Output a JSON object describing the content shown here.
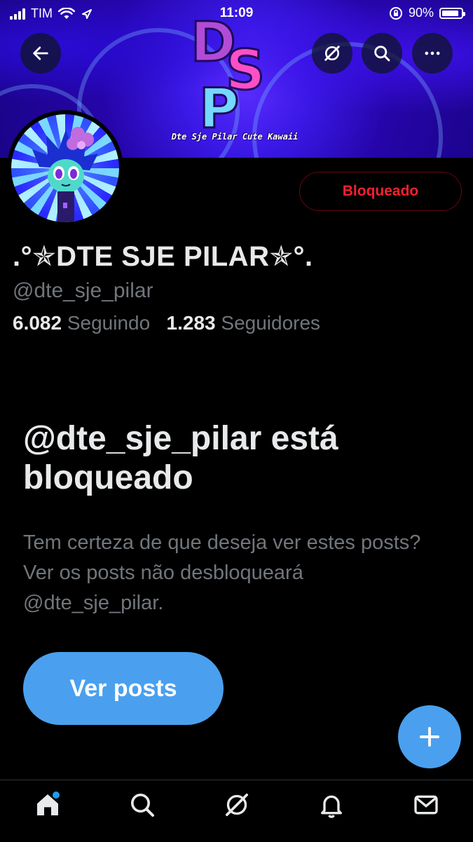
{
  "status_bar": {
    "carrier": "TIM",
    "time": "11:09",
    "battery_percent": "90%",
    "battery_level": 0.9,
    "icons": [
      "signal-icon",
      "wifi-icon",
      "location-icon",
      "orientation-lock-icon",
      "battery-icon"
    ]
  },
  "header": {
    "banner_logo_letters": [
      "D",
      "S",
      "P"
    ],
    "banner_tagline": "Dte Sje Pilar Cute Kawaii",
    "icons": [
      "back-arrow-icon",
      "grok-icon",
      "search-icon",
      "more-icon"
    ]
  },
  "profile": {
    "blocked_button_label": "Bloqueado",
    "display_name": ".°✯DTE SJE PILAR✯°.",
    "handle": "@dte_sje_pilar",
    "following_count": "6.082",
    "following_label": "Seguindo",
    "followers_count": "1.283",
    "followers_label": "Seguidores"
  },
  "blocked_notice": {
    "title": "@dte_sje_pilar está bloqueado",
    "description": "Tem certeza de que deseja ver estes posts? Ver os posts não desbloqueará @dte_sje_pilar.",
    "view_posts_label": "Ver posts"
  },
  "fab": {
    "icon": "plus-icon"
  },
  "bottom_nav": {
    "items": [
      "home-icon",
      "search-icon",
      "grok-icon",
      "notifications-icon",
      "messages-icon"
    ]
  },
  "colors": {
    "accent": "#4aa0ee",
    "blocked_red": "#f4212e",
    "muted_text": "#71767b",
    "primary_text": "#e7e9ea"
  }
}
